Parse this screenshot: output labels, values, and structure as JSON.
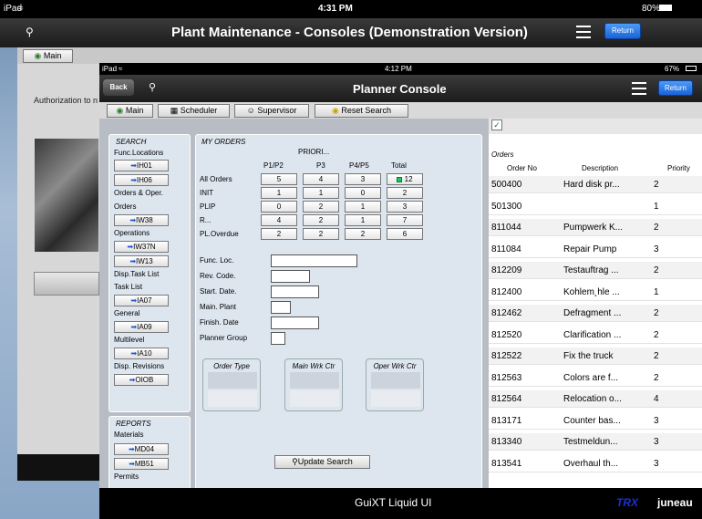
{
  "back": {
    "status": {
      "device": "iPad",
      "time": "4:31 PM",
      "battery": "80%"
    },
    "title": "Plant Maintenance - Consoles (Demonstration Version)",
    "return_label": "Return",
    "main_label": "Main",
    "auth_text": "Authorization to n"
  },
  "front": {
    "status": {
      "device": "iPad",
      "time": "4:12 PM",
      "battery": "67%"
    },
    "back_label": "Back",
    "title": "Planner Console",
    "return_label": "Return",
    "toolbar": {
      "main": "Main",
      "scheduler": "Scheduler",
      "supervisor": "Supervisor",
      "reset": "Reset Search"
    },
    "search": {
      "title": "SEARCH",
      "func_locations": "Func.Locations",
      "ih01": "IH01",
      "ih06": "IH06",
      "orders_oper": "Orders & Oper.",
      "orders": "Orders",
      "iw38": "IW38",
      "operations": "Operations",
      "iw37n": "IW37N",
      "iw13": "IW13",
      "disp_task_list": "Disp.Task List",
      "task_list": "Task List",
      "ia07": "IA07",
      "general": "General",
      "ia09": "IA09",
      "multilevel": "Multilevel",
      "ia10": "IA10",
      "disp_revisions": "Disp. Revisions",
      "oiob": "OIOB"
    },
    "reports": {
      "title": "REPORTS",
      "materials": "Materials",
      "md04": "MD04",
      "mb51": "MB51",
      "permits": "Permits"
    },
    "my_orders": {
      "title": "MY ORDERS",
      "priority_header": "PRIORI...",
      "cols": [
        "P1/P2",
        "P3",
        "P4/P5",
        "Total"
      ],
      "rows": [
        {
          "label": "All Orders",
          "values": [
            "5",
            "4",
            "3",
            "12"
          ]
        },
        {
          "label": "INIT",
          "values": [
            "1",
            "1",
            "0",
            "2"
          ]
        },
        {
          "label": "PLIP",
          "values": [
            "0",
            "2",
            "1",
            "3"
          ]
        },
        {
          "label": "R...",
          "values": [
            "4",
            "2",
            "1",
            "7"
          ]
        },
        {
          "label": "PL.Overdue",
          "values": [
            "2",
            "2",
            "2",
            "6"
          ]
        }
      ],
      "fields": [
        "Func. Loc.",
        "Rev. Code.",
        "Start. Date.",
        "Main. Plant",
        "Finish. Date",
        "Planner Group"
      ],
      "groups": [
        "Order Type",
        "Main Wrk Ctr",
        "Oper Wrk Ctr"
      ],
      "update_label": "Update Search"
    },
    "orders_table": {
      "title": "Orders",
      "headers": [
        "Order No",
        "Description",
        "Priority"
      ],
      "rows": [
        [
          "500400",
          "Hard disk pr...",
          "2"
        ],
        [
          "501300",
          "",
          "1"
        ],
        [
          "811044",
          "Pumpwerk K...",
          "2"
        ],
        [
          "811084",
          "Repair Pump",
          "3"
        ],
        [
          "812209",
          "Testauftrag ...",
          "2"
        ],
        [
          "812400",
          "Kohlem¸hle ...",
          "1"
        ],
        [
          "812462",
          "Defragment ...",
          "2"
        ],
        [
          "812520",
          "Clarification ...",
          "2"
        ],
        [
          "812522",
          "Fix the truck",
          "2"
        ],
        [
          "812563",
          "Colors are f...",
          "2"
        ],
        [
          "812564",
          "Relocation o...",
          "4"
        ],
        [
          "813171",
          "Counter bas...",
          "3"
        ],
        [
          "813340",
          "Testmeldun...",
          "3"
        ],
        [
          "813541",
          "Overhaul th...",
          "3"
        ]
      ]
    },
    "footer": {
      "title": "GuiXT Liquid UI",
      "brand": "TRX",
      "user": "juneau"
    }
  },
  "colors": {
    "accent_blue": "#1b63d6",
    "green_indicator": "#22c55e"
  }
}
